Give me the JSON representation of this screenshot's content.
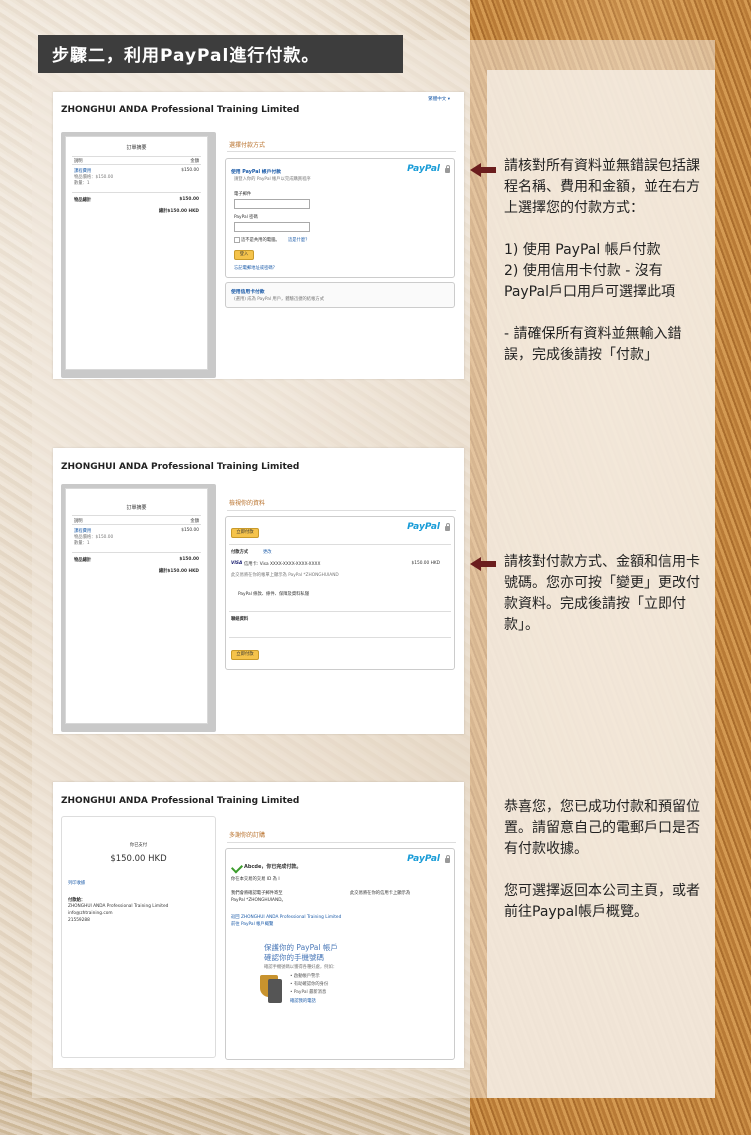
{
  "title": "步驟二，利用PayPal進行付款。",
  "company": "ZHONGHUI ANDA Professional Training Limited",
  "lang_link": "繁體中文 ▾",
  "paypal_logo": {
    "pay": "Pay",
    "pal": "Pal"
  },
  "order": {
    "summary_title": "訂單摘要",
    "col_desc": "說明",
    "col_amount": "金額",
    "item_name": "課程費用",
    "item_price_line": "物品價格：$150.00",
    "item_qty_line": "數量：1",
    "item_amount": "$150.00",
    "subtotal_label": "物品總計",
    "subtotal": "$150.00",
    "total": "總計$150.00 HKD"
  },
  "step1": {
    "section_title": "選擇付款方式",
    "paypal_option": "使用 PayPal 帳戶付款",
    "paypal_hint": "請登入你的 PayPal 帳戶以完成購買程序",
    "email_label": "電子郵件",
    "password_label": "PayPal 密碼",
    "public_pc": "這不是共用的電腦。",
    "whats_this": "這是什麼？",
    "login_button": "登入",
    "forgot": "忘記電郵地址或密碼？",
    "card_option": "使用信用卡付款",
    "card_hint": "(選用) 成為 PayPal 用戶，體驗迅捷的結帳方式"
  },
  "step2": {
    "section_title": "檢視你的資料",
    "pay_now_button": "立即付款",
    "payment_method_label": "付款方式",
    "change_link": "更改",
    "visa": "VISA",
    "card_line": "信用卡: Visa XXXX-XXXX-XXXX-XXXX",
    "card_amount": "$150.00 HKD",
    "statement_line": "此交易將在你的帳單上顯示為 PayPal *ZHONGHUIAND",
    "terms_line": "PayPal 條款、條件、保障及資料私隱",
    "contact_label": "聯絡資料"
  },
  "step3": {
    "paid_label": "你已支付",
    "amount": "$150.00 HKD",
    "print_link": "列印收據",
    "payee_label": "付款給：",
    "payee_name": "ZHONGHUI ANDA Professional Training Limited",
    "payee_email": "info@zhtraining.com",
    "payee_phone": "21559288",
    "section_title": "多謝你的訂購",
    "done_line": "Abcde，你已完成付款。",
    "txn_line": "你在本交易的交易 ID 為 I",
    "email_note": "我們會將確認電子郵件寄至",
    "merchant_line": "PayPal *ZHONGHUIAND。",
    "statement_line": "此交易將在你的信用卡上顯示為",
    "return_link": "返回 ZHONGHUI ANDA Professional Training Limited",
    "account_link": "前往 PayPal 帳戶概覽",
    "promo_title1": "保護你的 PayPal 帳戶",
    "promo_title2": "確認你的手機號碼",
    "promo_sub": "確認手機號碼以獲得各種好處，例如：",
    "promo_b1": "• 啟動帳戶警示",
    "promo_b2": "• 有助確認你的身份",
    "promo_b3": "• PayPal 最新消息",
    "promo_link": "確認我的電話"
  },
  "desc1": "請核對所有資料並無錯誤包括課程名稱、費用和金額，並在右方上選擇您的付款方式：\n\n1) 使用 PayPal 帳戶付款\n2) 使用信用卡付款 - 沒有PayPal戶口用戶可選擇此項\n\n- 請確保所有資料並無輸入錯誤，完成後請按「付款」",
  "desc2": "請核對付款方式、金額和信用卡號碼。您亦可按「變更」更改付款資料。完成後請按「立即付款」。",
  "desc3": "恭喜您，您已成功付款和預留位置。請留意自己的電郵戶口是否有付款收據。\n\n您可選擇返回本公司主頁，或者前往Paypal帳戶概覽。"
}
